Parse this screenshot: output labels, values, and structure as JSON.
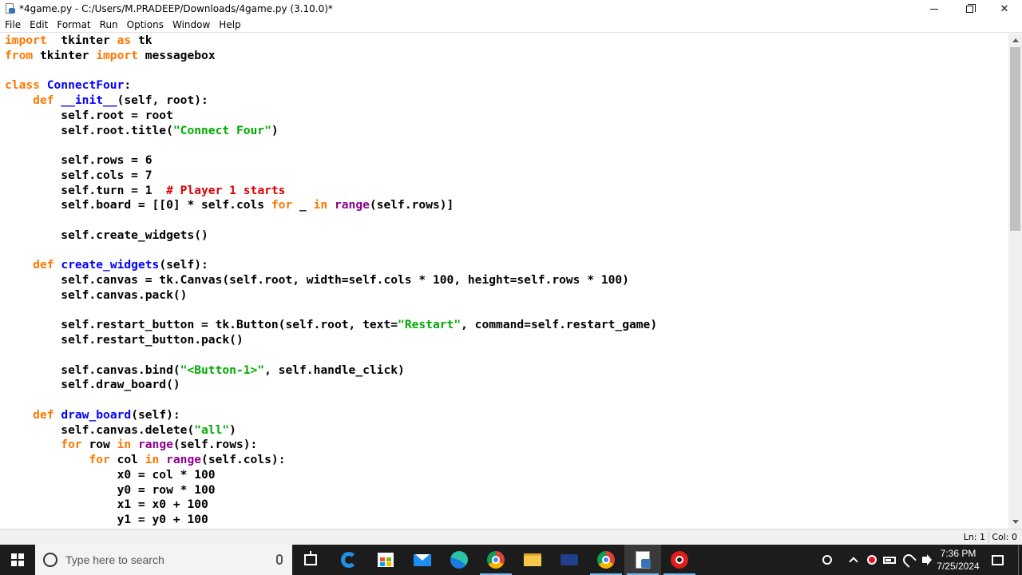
{
  "window": {
    "title": "*4game.py - C:/Users/M.PRADEEP/Downloads/4game.py (3.10.0)*",
    "controls": {
      "minimize": "—",
      "maximize": "❐",
      "close": "✕"
    }
  },
  "menu": [
    "File",
    "Edit",
    "Format",
    "Run",
    "Options",
    "Window",
    "Help"
  ],
  "syntax_colors": {
    "keyword": "#ff7700",
    "definition": "#0000ff",
    "builtin": "#900090",
    "string": "#00aa00",
    "comment": "#dd0000",
    "default": "#000000"
  },
  "code_lines": [
    [
      [
        "kw",
        "import"
      ],
      [
        "",
        "  tkinter "
      ],
      [
        "kw",
        "as"
      ],
      [
        "",
        " tk"
      ]
    ],
    [
      [
        "kw",
        "from"
      ],
      [
        "",
        " tkinter "
      ],
      [
        "kw",
        "import"
      ],
      [
        "",
        " messagebox"
      ]
    ],
    [],
    [
      [
        "kw",
        "class"
      ],
      [
        "",
        " "
      ],
      [
        "fn",
        "ConnectFour"
      ],
      [
        "",
        ":"
      ]
    ],
    [
      [
        "",
        "    "
      ],
      [
        "kw",
        "def"
      ],
      [
        "",
        " "
      ],
      [
        "fn",
        "__init__"
      ],
      [
        "",
        "(self, root):"
      ]
    ],
    [
      [
        "",
        "        self.root = root"
      ]
    ],
    [
      [
        "",
        "        self.root.title("
      ],
      [
        "st",
        "\"Connect Four\""
      ],
      [
        "",
        ")"
      ]
    ],
    [],
    [
      [
        "",
        "        self.rows = 6"
      ]
    ],
    [
      [
        "",
        "        self.cols = 7"
      ]
    ],
    [
      [
        "",
        "        self.turn = 1  "
      ],
      [
        "cm",
        "# Player 1 starts"
      ]
    ],
    [
      [
        "",
        "        self.board = [[0] * self.cols "
      ],
      [
        "kw",
        "for"
      ],
      [
        "",
        " _ "
      ],
      [
        "kw",
        "in"
      ],
      [
        "",
        " "
      ],
      [
        "bi",
        "range"
      ],
      [
        "",
        "(self.rows)]"
      ]
    ],
    [],
    [
      [
        "",
        "        self.create_widgets()"
      ]
    ],
    [],
    [
      [
        "",
        "    "
      ],
      [
        "kw",
        "def"
      ],
      [
        "",
        " "
      ],
      [
        "fn",
        "create_widgets"
      ],
      [
        "",
        "(self):"
      ]
    ],
    [
      [
        "",
        "        self.canvas = tk.Canvas(self.root, width=self.cols * 100, height=self.rows * 100)"
      ]
    ],
    [
      [
        "",
        "        self.canvas.pack()"
      ]
    ],
    [],
    [
      [
        "",
        "        self.restart_button = tk.Button(self.root, text="
      ],
      [
        "st",
        "\"Restart\""
      ],
      [
        "",
        ", command=self.restart_game)"
      ]
    ],
    [
      [
        "",
        "        self.restart_button.pack()"
      ]
    ],
    [],
    [
      [
        "",
        "        self.canvas.bind("
      ],
      [
        "st",
        "\"<Button-1>\""
      ],
      [
        "",
        ", self.handle_click)"
      ]
    ],
    [
      [
        "",
        "        self.draw_board()"
      ]
    ],
    [],
    [
      [
        "",
        "    "
      ],
      [
        "kw",
        "def"
      ],
      [
        "",
        " "
      ],
      [
        "fn",
        "draw_board"
      ],
      [
        "",
        "(self):"
      ]
    ],
    [
      [
        "",
        "        self.canvas.delete("
      ],
      [
        "st",
        "\"all\""
      ],
      [
        "",
        ")"
      ]
    ],
    [
      [
        "",
        "        "
      ],
      [
        "kw",
        "for"
      ],
      [
        "",
        " row "
      ],
      [
        "kw",
        "in"
      ],
      [
        "",
        " "
      ],
      [
        "bi",
        "range"
      ],
      [
        "",
        "(self.rows):"
      ]
    ],
    [
      [
        "",
        "            "
      ],
      [
        "kw",
        "for"
      ],
      [
        "",
        " col "
      ],
      [
        "kw",
        "in"
      ],
      [
        "",
        " "
      ],
      [
        "bi",
        "range"
      ],
      [
        "",
        "(self.cols):"
      ]
    ],
    [
      [
        "",
        "                x0 = col * 100"
      ]
    ],
    [
      [
        "",
        "                y0 = row * 100"
      ]
    ],
    [
      [
        "",
        "                x1 = x0 + 100"
      ]
    ],
    [
      [
        "",
        "                y1 = y0 + 100"
      ]
    ]
  ],
  "status": {
    "line": "Ln: 1",
    "col": "Col: 0"
  },
  "taskbar": {
    "search_placeholder": "Type here to search",
    "apps": [
      "task-view",
      "edge-legacy",
      "microsoft-store",
      "mail",
      "edge",
      "chrome-1",
      "file-explorer",
      "vscode",
      "chrome-2",
      "python-idle",
      "screen-recorder"
    ],
    "clock_time": "7:36 PM",
    "clock_date": "7/25/2024"
  }
}
